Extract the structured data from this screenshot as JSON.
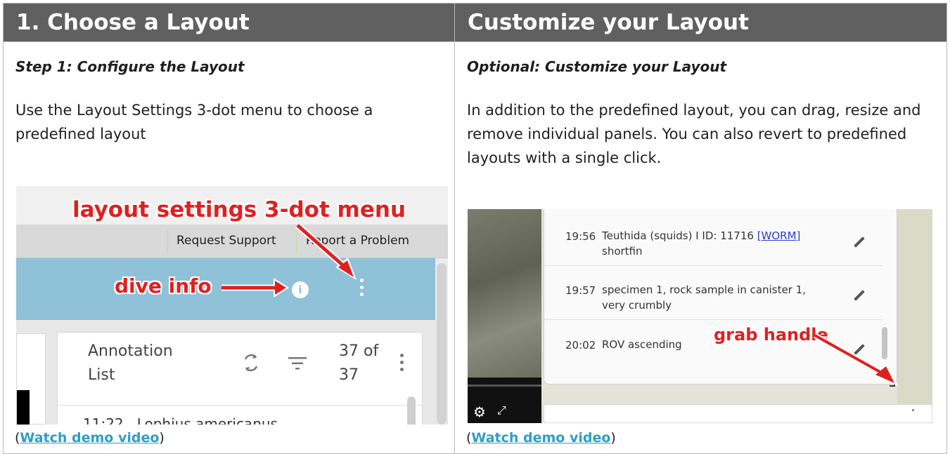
{
  "left": {
    "header": "1. Choose a Layout",
    "step": "Step 1: Configure the Layout",
    "description": "Use the Layout Settings 3-dot menu to choose a predefined layout",
    "demo_prefix": "(",
    "demo_link": "Watch demo video",
    "demo_suffix": ")",
    "screenshot": {
      "callout_menu": "layout settings 3-dot menu",
      "callout_info": "dive info",
      "link_support": "Request Support",
      "link_problem": "Report a Problem",
      "info_glyph": "i",
      "panel_title_line1": "Annotation",
      "panel_title_line2": "List",
      "count_line1": "37 of",
      "count_line2": "37",
      "first_row": "11:22   Lophius americanus"
    }
  },
  "right": {
    "header": "Customize your Layout",
    "step": "Optional: Customize your Layout",
    "description": "In addition to the predefined layout, you can drag, resize and remove individual panels. You can also revert to predefined layouts with a single click.",
    "demo_prefix": "(",
    "demo_link": "Watch demo video",
    "demo_suffix": ")",
    "screenshot": {
      "callout_handle": "grab handle",
      "rows": [
        {
          "time": "19:56",
          "text": "Teuthida (squids) I ID: 11716 ",
          "link": "[WORM]",
          "text2": "shortfin"
        },
        {
          "time": "19:57",
          "text": "specimen 1, rock sample in canister 1,",
          "text2": "very crumbly"
        },
        {
          "time": "20:02",
          "text": "ROV ascending"
        }
      ]
    }
  },
  "colors": {
    "header_bg": "#606060",
    "link": "#2e9fc4",
    "callout": "#e02020",
    "toolbar_blue": "#8fc1d8"
  }
}
